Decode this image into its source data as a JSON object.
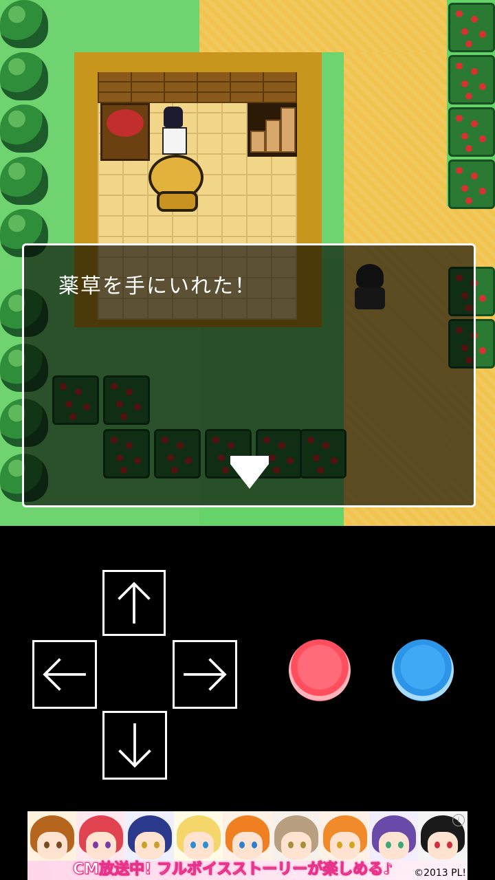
{
  "dialog": {
    "message": "薬草を手にいれた！"
  },
  "controls": {
    "up": "up-arrow-icon",
    "down": "down-arrow-icon",
    "left": "left-arrow-icon",
    "right": "right-arrow-icon",
    "a_color": "#ff5a68",
    "b_color": "#3aa2f0"
  },
  "banner": {
    "text": "CM放送中! フルボイスストーリーが楽しめる♪",
    "copyright": "©2013 PL!",
    "info": "i"
  }
}
